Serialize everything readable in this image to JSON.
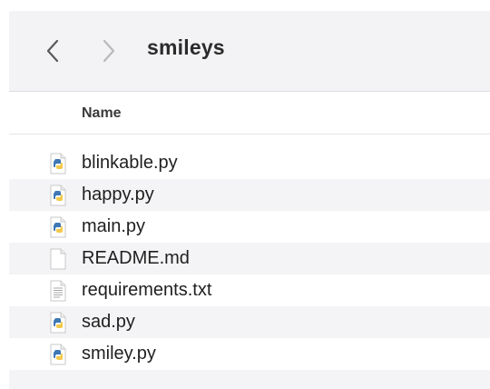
{
  "toolbar": {
    "back_icon": "chevron-left-icon",
    "forward_icon": "chevron-right-icon",
    "title": "smileys"
  },
  "columns": {
    "name": "Name"
  },
  "files": [
    {
      "name": "blinkable.py",
      "icon": "python-file-icon"
    },
    {
      "name": "happy.py",
      "icon": "python-file-icon"
    },
    {
      "name": "main.py",
      "icon": "python-file-icon"
    },
    {
      "name": "README.md",
      "icon": "blank-document-icon"
    },
    {
      "name": "requirements.txt",
      "icon": "text-document-icon"
    },
    {
      "name": "sad.py",
      "icon": "python-file-icon"
    },
    {
      "name": "smiley.py",
      "icon": "python-file-icon"
    }
  ],
  "colors": {
    "toolbar_bg": "#f3f2f5",
    "stripe": "#f4f4f6",
    "python_blue": "#3f78b5",
    "python_yellow": "#f2c94c"
  }
}
